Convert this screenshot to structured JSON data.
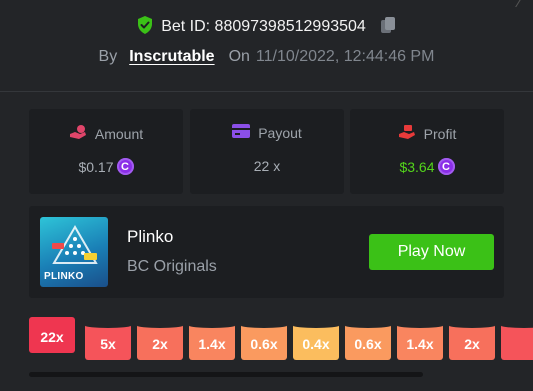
{
  "header": {
    "bet_id_text": "Bet ID: 88097398512993504",
    "by_label": "By",
    "username": "Inscrutable",
    "on_label": "On",
    "datetime": "11/10/2022, 12:44:46 PM"
  },
  "stats": [
    {
      "label": "Amount",
      "value": "$0.17",
      "icon": "hand-coin-icon",
      "color": "#e0456a"
    },
    {
      "label": "Payout",
      "value": "22 x",
      "icon": "wallet-icon",
      "color": "#8b4fe8"
    },
    {
      "label": "Profit",
      "value": "$3.64",
      "icon": "hand-gift-icon",
      "color": "#e83a3a"
    }
  ],
  "coin_symbol": "C",
  "game": {
    "title": "Plinko",
    "subtitle": "BC Originals",
    "play_label": "Play Now",
    "thumb_text": "PLINKO"
  },
  "multipliers": [
    {
      "label": "22x",
      "color": "#ef3650",
      "active": true
    },
    {
      "label": "5x",
      "color": "#f5545a"
    },
    {
      "label": "2x",
      "color": "#f7705c"
    },
    {
      "label": "1.4x",
      "color": "#f9855f"
    },
    {
      "label": "0.6x",
      "color": "#fa9a5f"
    },
    {
      "label": "0.4x",
      "color": "#fbbd5e"
    },
    {
      "label": "0.6x",
      "color": "#fa9a5f"
    },
    {
      "label": "1.4x",
      "color": "#f9855f"
    },
    {
      "label": "2x",
      "color": "#f7705c"
    },
    {
      "label": "",
      "color": "#f5545a"
    }
  ],
  "colors": {
    "background": "#232528",
    "card": "#1c1e21",
    "play_button": "#3bc117",
    "profit": "#53d41b",
    "coin": "#8b2ee8"
  }
}
